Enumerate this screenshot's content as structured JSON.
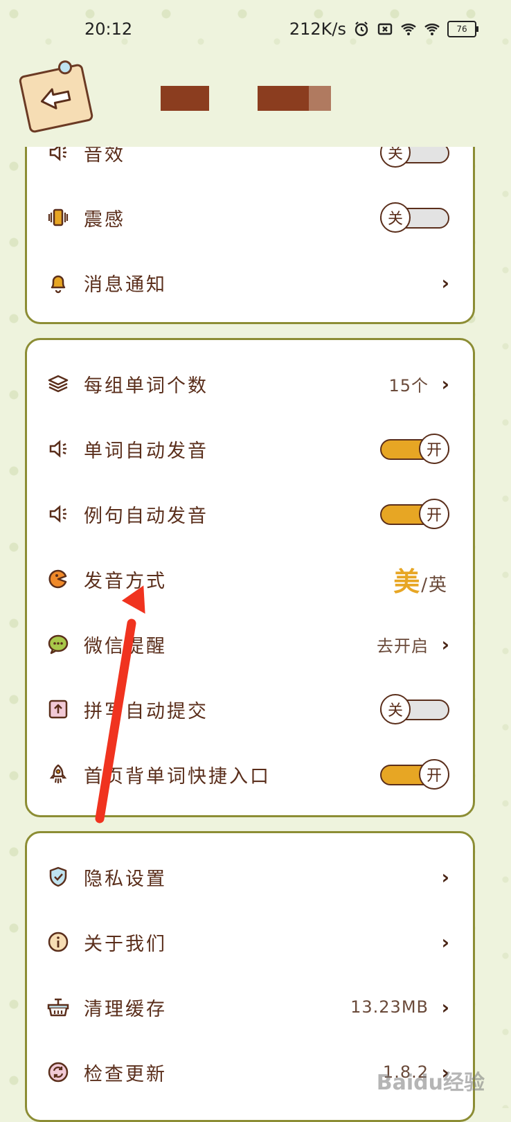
{
  "status_bar": {
    "time": "20:12",
    "network_speed": "212K/s",
    "battery": "76"
  },
  "header": {
    "back_icon": "back-arrow-icon"
  },
  "card1": {
    "rows": [
      {
        "label": "音效",
        "icon": "speaker-icon",
        "toggle": "关"
      },
      {
        "label": "震感",
        "icon": "vibration-icon",
        "toggle": "关"
      },
      {
        "label": "消息通知",
        "icon": "bell-icon",
        "chevron": "›"
      }
    ]
  },
  "card2": {
    "rows": [
      {
        "label": "每组单词个数",
        "icon": "layers-icon",
        "value": "15个",
        "chevron": "›"
      },
      {
        "label": "单词自动发音",
        "icon": "speaker-icon",
        "toggle": "开"
      },
      {
        "label": "例句自动发音",
        "icon": "speaker-icon",
        "toggle": "开"
      },
      {
        "label": "发音方式",
        "icon": "pacman-icon",
        "pron_active": "美",
        "pron_sep": "/",
        "pron_inactive": "英"
      },
      {
        "label": "微信提醒",
        "icon": "wechat-icon",
        "value": "去开启",
        "chevron": "›"
      },
      {
        "label": "拼写自动提交",
        "icon": "upload-icon",
        "toggle": "关"
      },
      {
        "label": "首页背单词快捷入口",
        "icon": "rocket-icon",
        "toggle": "开"
      }
    ]
  },
  "card3": {
    "rows": [
      {
        "label": "隐私设置",
        "icon": "shield-icon",
        "chevron": "›"
      },
      {
        "label": "关于我们",
        "icon": "info-icon",
        "chevron": "›"
      },
      {
        "label": "清理缓存",
        "icon": "basket-icon",
        "value": "13.23MB",
        "chevron": "›"
      },
      {
        "label": "检查更新",
        "icon": "refresh-icon",
        "value": "1.8.2",
        "chevron": "›"
      }
    ]
  },
  "watermark": "Baidu经验",
  "colors": {
    "background": "#eef3dd",
    "card_border": "#8c8d34",
    "accent": "#e7a624",
    "text": "#5a2e1b",
    "annotation_arrow": "#f0331f"
  }
}
